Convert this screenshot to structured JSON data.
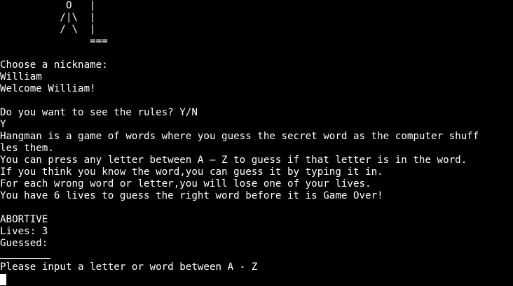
{
  "terminal": {
    "hangman_art": [
      "           O   |",
      "          /|\\  |",
      "          / \\  |",
      "               ==="
    ],
    "nickname_prompt": "Choose a nickname:",
    "nickname_input": "William",
    "welcome": "Welcome William!",
    "rules_prompt": "Do you want to see the rules? Y/N",
    "rules_answer": "Y",
    "rules": [
      "Hangman is a game of words where you guess the secret word as the computer shuff",
      "les them.",
      "You can press any letter between A — Z to guess if that letter is in the word.",
      "If you think you know the word,you can guess it by typing it in.",
      "For each wrong word or letter,you will lose one of your lives.",
      "You have 6 lives to guess the right word before it is Game Over!"
    ],
    "word": "ABORTIVE",
    "lives": "Lives: 3",
    "guessed": "Guessed:",
    "input_prompt": "Please input a letter or word between A - Z"
  }
}
